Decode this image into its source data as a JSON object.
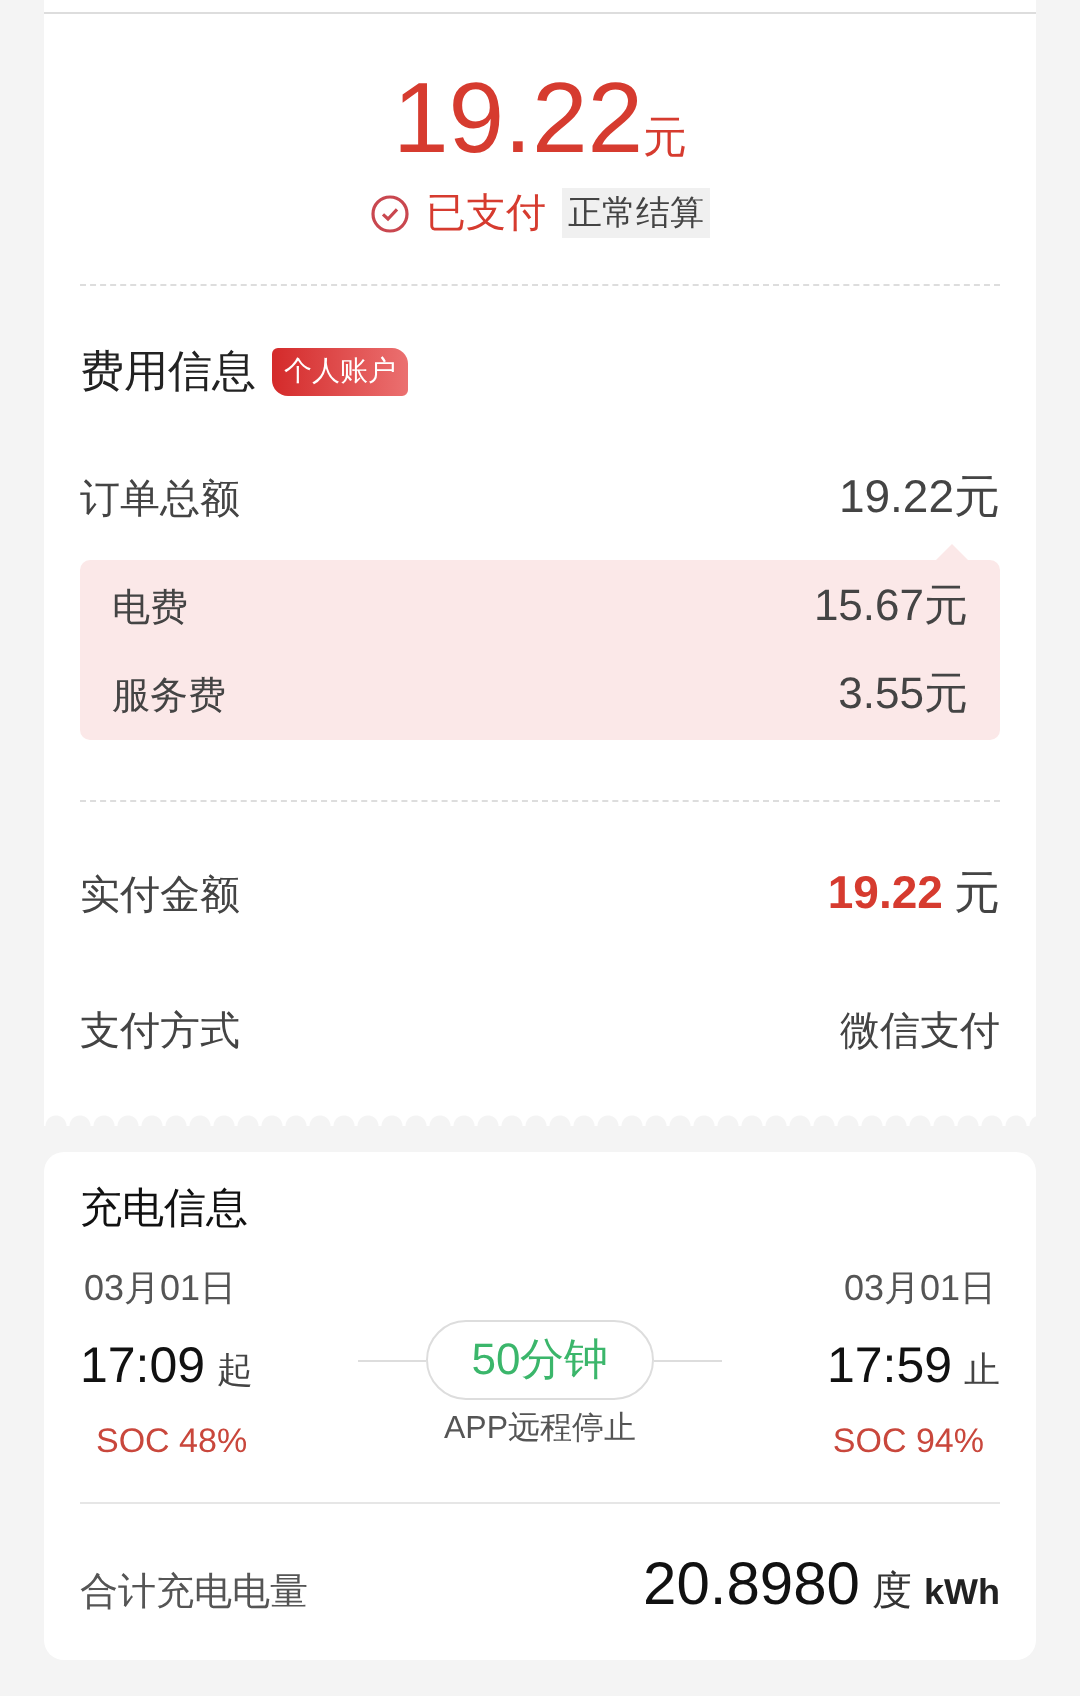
{
  "summary": {
    "amount": "19.22",
    "unit": "元",
    "status": "已支付",
    "settlement": "正常结算"
  },
  "fees": {
    "title": "费用信息",
    "badge": "个人账户",
    "total": {
      "label": "订单总额",
      "value": "19.22",
      "unit": "元"
    },
    "breakdown": [
      {
        "label": "电费",
        "value": "15.67",
        "unit": "元"
      },
      {
        "label": "服务费",
        "value": "3.55",
        "unit": "元"
      }
    ],
    "paid": {
      "label": "实付金额",
      "value": "19.22",
      "unit": "元"
    },
    "method": {
      "label": "支付方式",
      "value": "微信支付"
    }
  },
  "charging": {
    "title": "充电信息",
    "start": {
      "date": "03月01日",
      "time": "17:09",
      "mark": "起",
      "soc": "SOC 48%"
    },
    "duration": "50分钟",
    "stop_reason": "APP远程停止",
    "end": {
      "date": "03月01日",
      "time": "17:59",
      "mark": "止",
      "soc": "SOC 94%"
    },
    "energy": {
      "label": "合计充电电量",
      "value": "20.8980",
      "unit": "度",
      "unit2": "kWh"
    }
  }
}
